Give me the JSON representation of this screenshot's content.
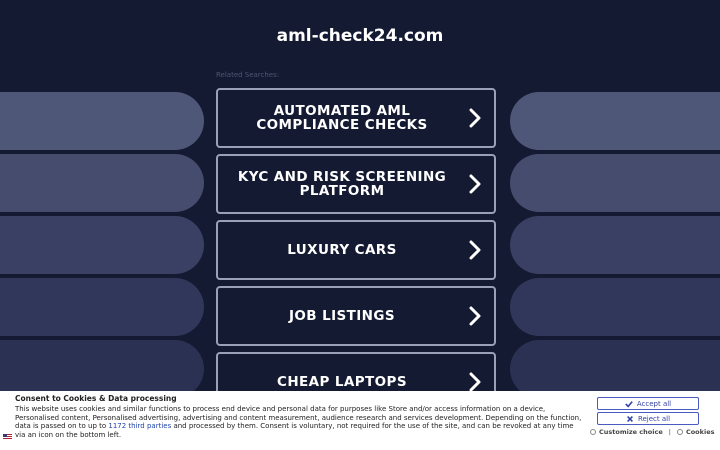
{
  "header": {
    "domain": "aml-check24.com"
  },
  "related_label": "Related Searches:",
  "links": [
    {
      "label": "AUTOMATED AML COMPLIANCE CHECKS"
    },
    {
      "label": "KYC AND RISK SCREENING PLATFORM"
    },
    {
      "label": "LUXURY CARS"
    },
    {
      "label": "JOB LISTINGS"
    },
    {
      "label": "CHEAP LAPTOPS"
    }
  ],
  "consent": {
    "title": "Consent to Cookies & Data processing",
    "text_before": "This website uses cookies and similar functions to process end device and personal data for purposes like Store and/or access information on a device, Personalised content, Personalised advertising, advertising and content measurement, audience research and services development. Depending on the function, data is passed on to up to ",
    "link_text": "1172 third parties",
    "text_after": " and processed by them. Consent is voluntary, not required for the use of the site, and can be revoked at any time via an icon on the bottom left.",
    "accept_label": "Accept all",
    "reject_label": "Reject all",
    "customize_label": "Customize choice",
    "separator": "|",
    "cookies_label": "Cookies"
  },
  "colors": {
    "background": "#141a31",
    "card_border": "#9aa0b8",
    "button_text": "#3444a8"
  },
  "icons": {
    "card_arrow": "chevron-right-icon",
    "accept": "check-icon",
    "reject": "close-icon"
  }
}
